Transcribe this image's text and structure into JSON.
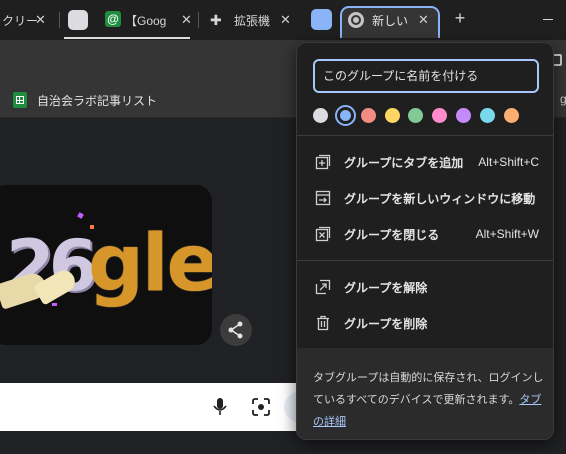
{
  "tabs": [
    {
      "title": "クリー",
      "icon": "generic-page-icon"
    },
    {
      "title": "",
      "icon": "blank-page-icon"
    },
    {
      "title": "【Goog",
      "icon": "sheets-at-icon"
    },
    {
      "title": "拡張機",
      "icon": "puzzle-icon"
    },
    {
      "title": "",
      "icon": "blank-page-icon"
    },
    {
      "title": "新しい",
      "icon": "chrome-icon"
    }
  ],
  "bookmarks": {
    "item_label": "自治会ラボ記事リスト"
  },
  "popup": {
    "name_placeholder": "このグループに名前を付ける",
    "colors": [
      "#dadce0",
      "#8ab4f8",
      "#f28b82",
      "#fdd663",
      "#81c995",
      "#ff8bcb",
      "#c58af9",
      "#78d9ec",
      "#fcad70"
    ],
    "selected_color_index": 1,
    "menu": {
      "add_tab": {
        "label": "グループにタブを追加",
        "shortcut": "Alt+Shift+C"
      },
      "move_window": {
        "label": "グループを新しいウィンドウに移動"
      },
      "close_group": {
        "label": "グループを閉じる",
        "shortcut": "Alt+Shift+W"
      },
      "ungroup": {
        "label": "グループを解除"
      },
      "delete_group": {
        "label": "グループを削除"
      }
    },
    "footer_text": "タブグループは自動的に保存され、ログインしているすべてのデバイスで更新されます。",
    "footer_link": "タブの詳細"
  },
  "doodle": {
    "text": "gle",
    "year": "26"
  }
}
